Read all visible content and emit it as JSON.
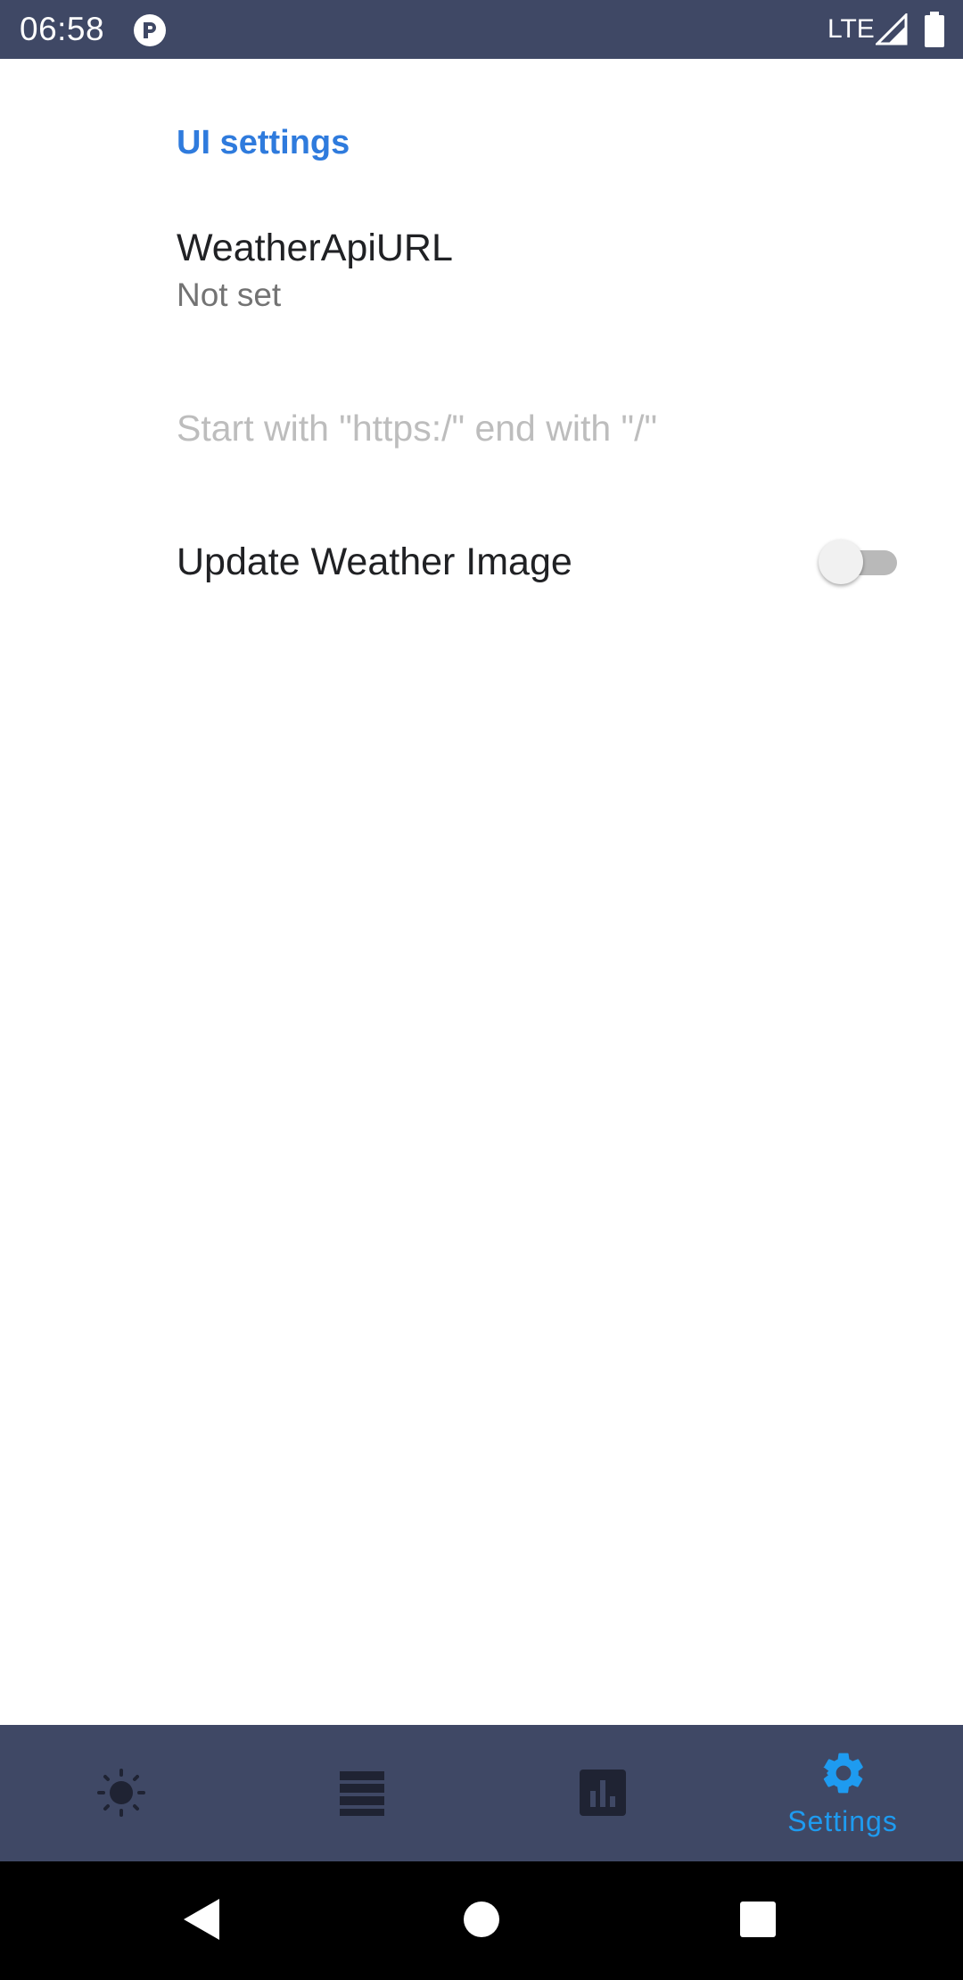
{
  "status_bar": {
    "time": "06:58",
    "network": "LTE"
  },
  "settings": {
    "section_header": "UI settings",
    "weather_api_url": {
      "title": "WeatherApiURL",
      "summary": "Not set",
      "hint": "Start with \"https:/\" end with \"/\""
    },
    "update_weather_image": {
      "label": "Update Weather Image",
      "enabled": false
    }
  },
  "bottom_nav": {
    "items": [
      {
        "icon": "sun-icon",
        "label": ""
      },
      {
        "icon": "list-icon",
        "label": ""
      },
      {
        "icon": "bar-chart-icon",
        "label": ""
      },
      {
        "icon": "gear-icon",
        "label": "Settings",
        "active": true
      }
    ],
    "active_color": "#1e9bf0",
    "inactive_color": "#1f2333"
  },
  "colors": {
    "status_bar_bg": "#3f4865",
    "accent": "#2f7bdd",
    "nav_bg": "#3f4865"
  },
  "system_nav": {
    "buttons": [
      "back",
      "home",
      "recents"
    ]
  }
}
